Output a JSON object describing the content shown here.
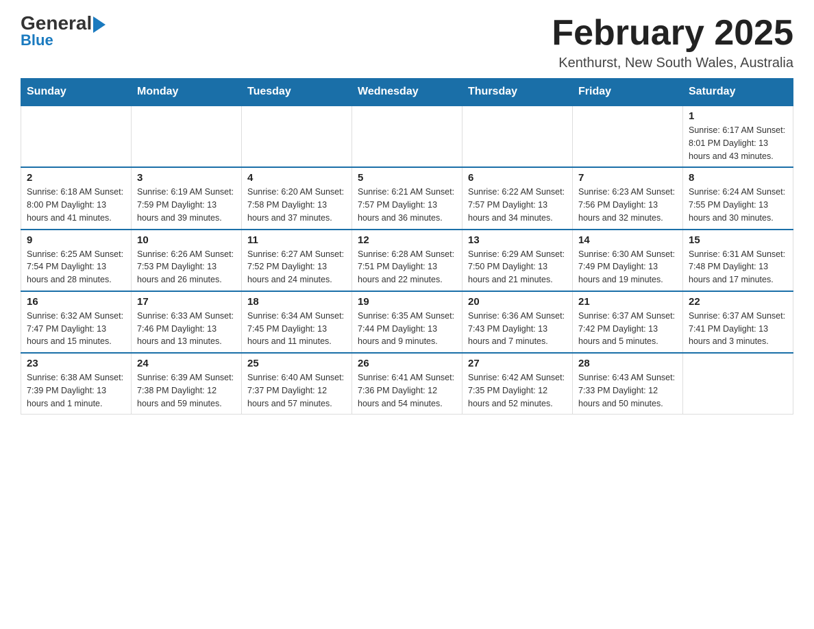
{
  "header": {
    "logo_line1_general": "General",
    "logo_line1_blue": "Blue",
    "month_title": "February 2025",
    "location": "Kenthurst, New South Wales, Australia"
  },
  "days_of_week": [
    "Sunday",
    "Monday",
    "Tuesday",
    "Wednesday",
    "Thursday",
    "Friday",
    "Saturday"
  ],
  "weeks": [
    [
      {
        "day": "",
        "info": ""
      },
      {
        "day": "",
        "info": ""
      },
      {
        "day": "",
        "info": ""
      },
      {
        "day": "",
        "info": ""
      },
      {
        "day": "",
        "info": ""
      },
      {
        "day": "",
        "info": ""
      },
      {
        "day": "1",
        "info": "Sunrise: 6:17 AM\nSunset: 8:01 PM\nDaylight: 13 hours and 43 minutes."
      }
    ],
    [
      {
        "day": "2",
        "info": "Sunrise: 6:18 AM\nSunset: 8:00 PM\nDaylight: 13 hours and 41 minutes."
      },
      {
        "day": "3",
        "info": "Sunrise: 6:19 AM\nSunset: 7:59 PM\nDaylight: 13 hours and 39 minutes."
      },
      {
        "day": "4",
        "info": "Sunrise: 6:20 AM\nSunset: 7:58 PM\nDaylight: 13 hours and 37 minutes."
      },
      {
        "day": "5",
        "info": "Sunrise: 6:21 AM\nSunset: 7:57 PM\nDaylight: 13 hours and 36 minutes."
      },
      {
        "day": "6",
        "info": "Sunrise: 6:22 AM\nSunset: 7:57 PM\nDaylight: 13 hours and 34 minutes."
      },
      {
        "day": "7",
        "info": "Sunrise: 6:23 AM\nSunset: 7:56 PM\nDaylight: 13 hours and 32 minutes."
      },
      {
        "day": "8",
        "info": "Sunrise: 6:24 AM\nSunset: 7:55 PM\nDaylight: 13 hours and 30 minutes."
      }
    ],
    [
      {
        "day": "9",
        "info": "Sunrise: 6:25 AM\nSunset: 7:54 PM\nDaylight: 13 hours and 28 minutes."
      },
      {
        "day": "10",
        "info": "Sunrise: 6:26 AM\nSunset: 7:53 PM\nDaylight: 13 hours and 26 minutes."
      },
      {
        "day": "11",
        "info": "Sunrise: 6:27 AM\nSunset: 7:52 PM\nDaylight: 13 hours and 24 minutes."
      },
      {
        "day": "12",
        "info": "Sunrise: 6:28 AM\nSunset: 7:51 PM\nDaylight: 13 hours and 22 minutes."
      },
      {
        "day": "13",
        "info": "Sunrise: 6:29 AM\nSunset: 7:50 PM\nDaylight: 13 hours and 21 minutes."
      },
      {
        "day": "14",
        "info": "Sunrise: 6:30 AM\nSunset: 7:49 PM\nDaylight: 13 hours and 19 minutes."
      },
      {
        "day": "15",
        "info": "Sunrise: 6:31 AM\nSunset: 7:48 PM\nDaylight: 13 hours and 17 minutes."
      }
    ],
    [
      {
        "day": "16",
        "info": "Sunrise: 6:32 AM\nSunset: 7:47 PM\nDaylight: 13 hours and 15 minutes."
      },
      {
        "day": "17",
        "info": "Sunrise: 6:33 AM\nSunset: 7:46 PM\nDaylight: 13 hours and 13 minutes."
      },
      {
        "day": "18",
        "info": "Sunrise: 6:34 AM\nSunset: 7:45 PM\nDaylight: 13 hours and 11 minutes."
      },
      {
        "day": "19",
        "info": "Sunrise: 6:35 AM\nSunset: 7:44 PM\nDaylight: 13 hours and 9 minutes."
      },
      {
        "day": "20",
        "info": "Sunrise: 6:36 AM\nSunset: 7:43 PM\nDaylight: 13 hours and 7 minutes."
      },
      {
        "day": "21",
        "info": "Sunrise: 6:37 AM\nSunset: 7:42 PM\nDaylight: 13 hours and 5 minutes."
      },
      {
        "day": "22",
        "info": "Sunrise: 6:37 AM\nSunset: 7:41 PM\nDaylight: 13 hours and 3 minutes."
      }
    ],
    [
      {
        "day": "23",
        "info": "Sunrise: 6:38 AM\nSunset: 7:39 PM\nDaylight: 13 hours and 1 minute."
      },
      {
        "day": "24",
        "info": "Sunrise: 6:39 AM\nSunset: 7:38 PM\nDaylight: 12 hours and 59 minutes."
      },
      {
        "day": "25",
        "info": "Sunrise: 6:40 AM\nSunset: 7:37 PM\nDaylight: 12 hours and 57 minutes."
      },
      {
        "day": "26",
        "info": "Sunrise: 6:41 AM\nSunset: 7:36 PM\nDaylight: 12 hours and 54 minutes."
      },
      {
        "day": "27",
        "info": "Sunrise: 6:42 AM\nSunset: 7:35 PM\nDaylight: 12 hours and 52 minutes."
      },
      {
        "day": "28",
        "info": "Sunrise: 6:43 AM\nSunset: 7:33 PM\nDaylight: 12 hours and 50 minutes."
      },
      {
        "day": "",
        "info": ""
      }
    ]
  ]
}
